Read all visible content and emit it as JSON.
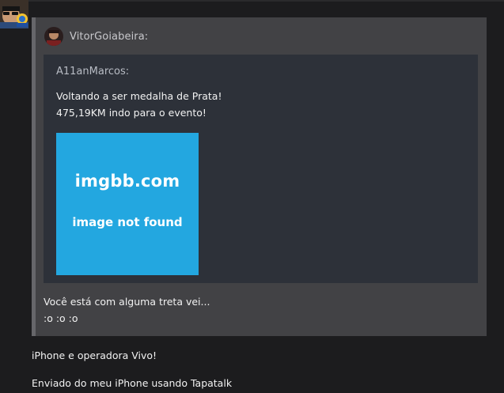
{
  "post": {
    "quote_outer": {
      "author": "VitorGoiabeira:",
      "quote_inner": {
        "author": "A11anMarcos:",
        "lines": [
          "Voltando a ser medalha de Prata!",
          "475,19KM indo para o evento!"
        ],
        "image_placeholder": {
          "site": "imgbb.com",
          "message": "image not found",
          "color": "#23a7e0"
        }
      },
      "lines": [
        "Você está com alguma treta vei...",
        ":o :o :o"
      ]
    },
    "reply": {
      "lines": [
        "iPhone e operadora Vivo!",
        "Enviado do meu iPhone usando Tapatalk"
      ]
    }
  },
  "colors": {
    "page_bg": "#1c1c1e",
    "quote_bg": "#424245",
    "nested_quote_bg": "#2d3139"
  }
}
